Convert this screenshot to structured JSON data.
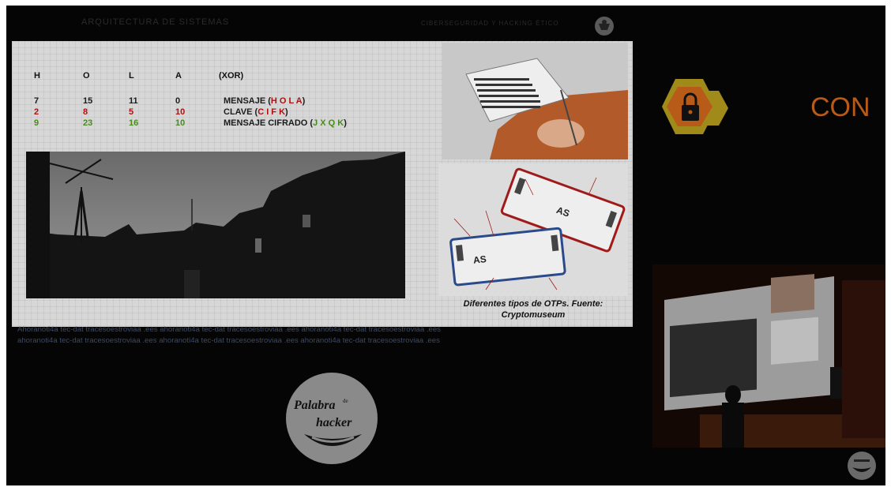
{
  "topbar": {
    "left_text": "ARQUITECTURA DE SISTEMAS",
    "right_text": "CIBERSEGURIDAD Y HACKING ÉTICO"
  },
  "slide": {
    "headers": [
      "H",
      "O",
      "L",
      "A",
      "(XOR)"
    ],
    "rows": [
      {
        "values": [
          "7",
          "15",
          "11",
          "0"
        ],
        "label_prefix": "MENSAJE (",
        "label_highlight": "H O L A",
        "label_suffix": ")",
        "color": "#1b1b1b"
      },
      {
        "values": [
          "2",
          "8",
          "5",
          "10"
        ],
        "label_prefix": "CLAVE  (",
        "label_highlight": "C I F K",
        "label_suffix": ")",
        "color": "#b10f0f"
      },
      {
        "values": [
          "9",
          "23",
          "16",
          "10"
        ],
        "label_prefix": "MENSAJE CIFRADO (",
        "label_highlight": "J X Q K",
        "label_suffix": ")",
        "color": "#4a8a20"
      }
    ],
    "caption_line1": "Diferentes tipos de OTPs. Fuente:",
    "caption_line2": "Cryptomuseum",
    "diagram_labels": {
      "card1": "AS",
      "card2": "AS"
    }
  },
  "ticker": {
    "line1": "Ahoranoti4a tec-dat tracesoestroviaa .ees ahoranoti4a tec-dat tracesoestroviaa .ees ahoranoti4a tec-dat tracesoestroviaa .ees",
    "line2": "ahoranoti4a tec-dat tracesoestroviaa .ees ahoranoti4a tec-dat tracesoestroviaa .ees ahoranoti4a tec-dat tracesoestroviaa .ees"
  },
  "branding": {
    "con_text": "CON",
    "palabra_line1": "Palabra",
    "palabra_de": "de",
    "palabra_line2": "hacker",
    "lock_color": "#b85a18",
    "hex_color": "#a08a1a"
  },
  "colors": {
    "background": "#050505",
    "accent": "#b85a18"
  }
}
